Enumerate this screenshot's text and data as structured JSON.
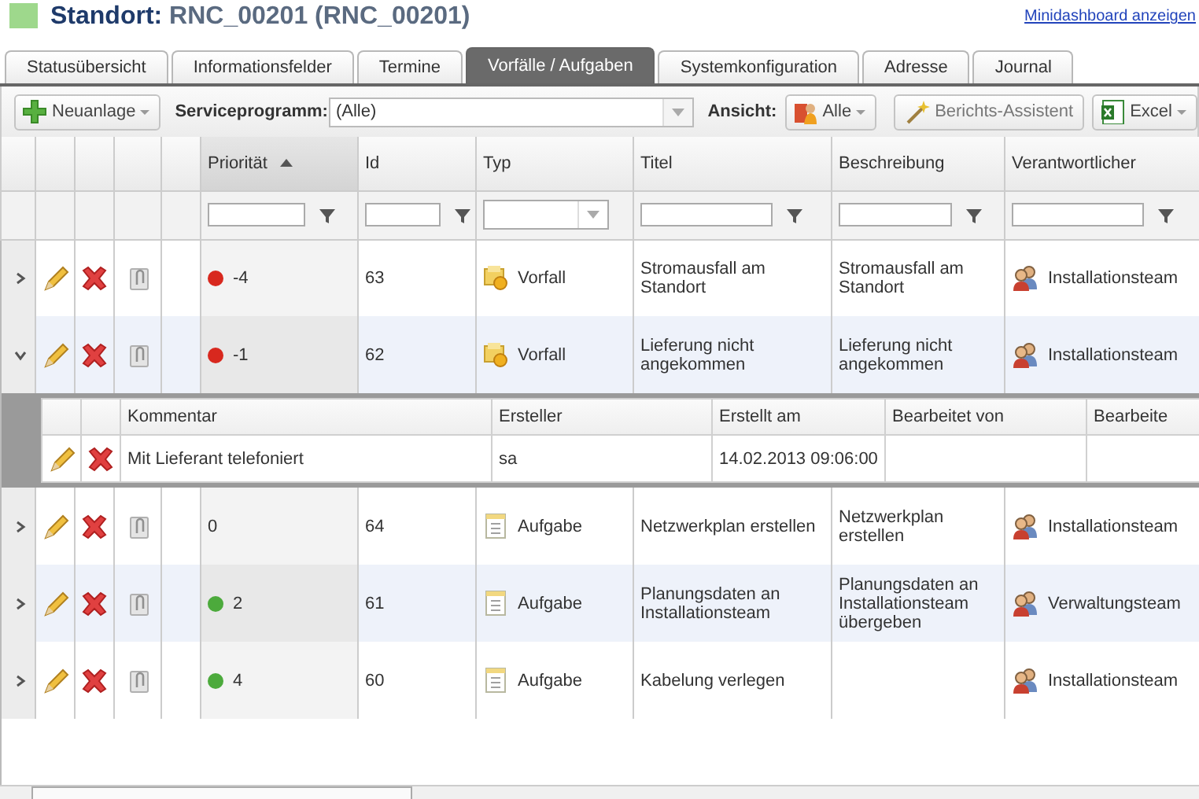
{
  "header": {
    "title_label": "Standort:",
    "title_value": "RNC_00201 (RNC_00201)",
    "link": "Minidashboard anzeigen"
  },
  "tabs": [
    {
      "label": "Statusübersicht",
      "selected": false
    },
    {
      "label": "Informationsfelder",
      "selected": false
    },
    {
      "label": "Termine",
      "selected": false
    },
    {
      "label": "Vorfälle / Aufgaben",
      "selected": true
    },
    {
      "label": "Systemkonfiguration",
      "selected": false
    },
    {
      "label": "Adresse",
      "selected": false
    },
    {
      "label": "Journal",
      "selected": false
    }
  ],
  "toolbar": {
    "new_button": "Neuanlage",
    "program_label": "Serviceprogramm:",
    "program_value": "(Alle)",
    "view_label": "Ansicht:",
    "view_value": "Alle",
    "report_button": "Berichts-Assistent",
    "export_button": "Excel"
  },
  "table": {
    "columns": [
      {
        "label": "Priorität",
        "sorted": true,
        "dropdown_filter": false
      },
      {
        "label": "Id",
        "sorted": false,
        "dropdown_filter": false
      },
      {
        "label": "Typ",
        "sorted": false,
        "dropdown_filter": true
      },
      {
        "label": "Titel",
        "sorted": false,
        "dropdown_filter": false
      },
      {
        "label": "Beschreibung",
        "sorted": false,
        "dropdown_filter": false
      },
      {
        "label": "Verantwortlicher",
        "sorted": false,
        "dropdown_filter": false
      }
    ],
    "rows": [
      {
        "expanded": false,
        "priority": "-4",
        "color": "#d8281e",
        "id": "63",
        "type": {
          "kind": "incident",
          "label": "Vorfall"
        },
        "title": "Stromausfall am Standort",
        "description": "Stromausfall am Standort",
        "owner": "Installationsteam"
      },
      {
        "expanded": true,
        "priority": "-1",
        "color": "#d8281e",
        "id": "62",
        "type": {
          "kind": "incident",
          "label": "Vorfall"
        },
        "title": "Lieferung nicht angekommen",
        "description": "Lieferung nicht angekommen",
        "owner": "Installationsteam",
        "detail": {
          "columns": [
            "Kommentar",
            "Ersteller",
            "Erstellt am",
            "Bearbeitet von",
            "Bearbeite"
          ],
          "rows": [
            {
              "cells": [
                "Mit Lieferant telefoniert",
                "sa",
                "14.02.2013 09:06:00"
              ]
            }
          ]
        }
      },
      {
        "expanded": false,
        "priority": "0",
        "id": "64",
        "type": {
          "kind": "task",
          "label": "Aufgabe"
        },
        "title": "Netzwerkplan erstellen",
        "description": "Netzwerkplan erstellen",
        "owner": "Installationsteam"
      },
      {
        "expanded": false,
        "priority": "2",
        "color": "#4caa3c",
        "id": "61",
        "type": {
          "kind": "task",
          "label": "Aufgabe"
        },
        "title": "Planungsdaten an Installationsteam",
        "description": "Planungsdaten an Installationsteam übergeben",
        "owner": "Verwaltungsteam"
      },
      {
        "expanded": false,
        "priority": "4",
        "color": "#4caa3c",
        "id": "60",
        "type": {
          "kind": "task",
          "label": "Aufgabe"
        },
        "title": "Kabelung verlegen",
        "owner": "Installationsteam"
      }
    ]
  }
}
